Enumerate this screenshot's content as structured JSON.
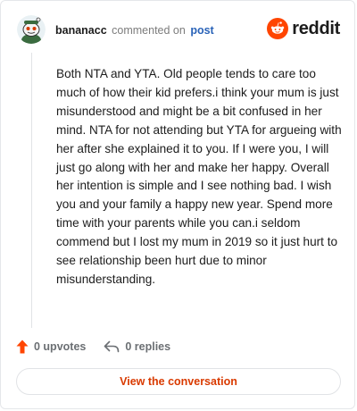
{
  "header": {
    "username": "bananacc",
    "verb": "commented on",
    "post_link": "post",
    "brand": "reddit",
    "brand_color": "#ff4500",
    "avatar_icon": "snoo-avatar-icon"
  },
  "comment": {
    "text": "Both NTA and YTA. Old people tends to care too much of how their kid prefers.i think your mum is just misunderstood and might be a bit confused in her mind. NTA for not attending but YTA for argueing with her after she explained it to you. If I were you, I will just go along with her and make her happy. Overall her intention is simple and I see nothing bad. I wish you and your family a happy new year. Spend more time with your parents while you can.i seldom commend but I lost my mum in 2019 so it just hurt to see relationship been hurt due to minor misunderstanding."
  },
  "actions": {
    "upvotes_label": "0 upvotes",
    "replies_label": "0 replies",
    "upvote_icon": "upvote-arrow-icon",
    "reply_icon": "reply-arrow-icon"
  },
  "cta": {
    "label": "View the conversation",
    "color": "#d93a00"
  }
}
